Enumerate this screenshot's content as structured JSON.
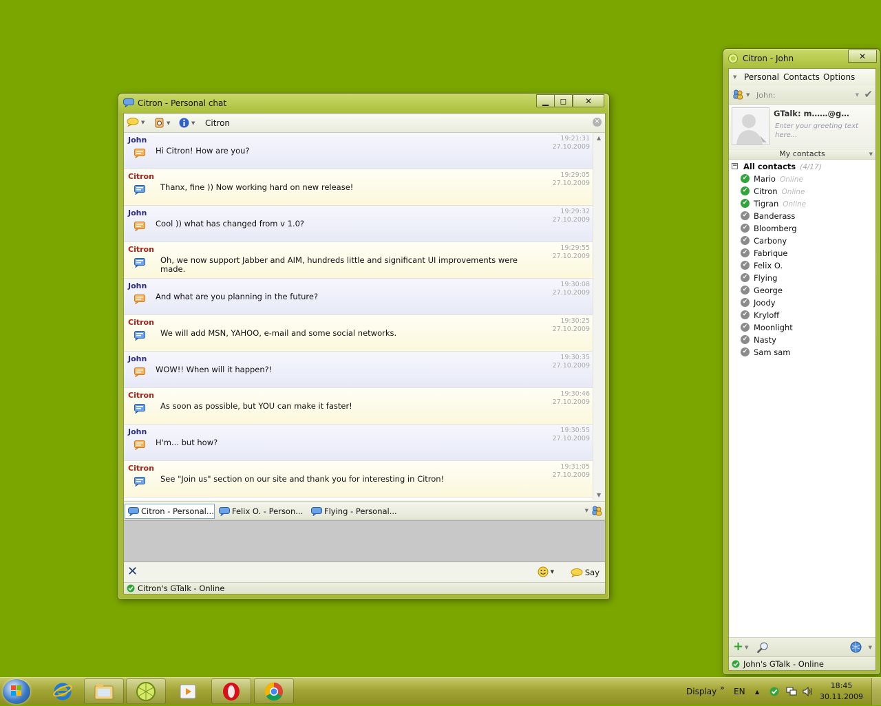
{
  "chat_window": {
    "title": "Citron - Personal chat",
    "partner_name": "Citron",
    "messages": [
      {
        "sender": "John",
        "text": "Hi Citron! How are you?",
        "time": "19:21:31",
        "date": "27.10.2009",
        "role": "john"
      },
      {
        "sender": "Citron",
        "text": "Thanx, fine )) Now working hard on new release!",
        "time": "19:29:05",
        "date": "27.10.2009",
        "role": "citron"
      },
      {
        "sender": "John",
        "text": "Cool )) what has changed from v 1.0?",
        "time": "19:29:32",
        "date": "27.10.2009",
        "role": "john"
      },
      {
        "sender": "Citron",
        "text": "Oh, we now support Jabber and AIM, hundreds little and significant UI improvements were made.",
        "time": "19:29:55",
        "date": "27.10.2009",
        "role": "citron"
      },
      {
        "sender": "John",
        "text": "And what are you planning in the future?",
        "time": "19:30:08",
        "date": "27.10.2009",
        "role": "john"
      },
      {
        "sender": "Citron",
        "text": "We will add MSN, YAHOO, e-mail and some social networks.",
        "time": "19:30:25",
        "date": "27.10.2009",
        "role": "citron"
      },
      {
        "sender": "John",
        "text": "WOW!! When will it happen?!",
        "time": "19:30:35",
        "date": "27.10.2009",
        "role": "john"
      },
      {
        "sender": "Citron",
        "text": "As soon as possible, but YOU can make it faster!",
        "time": "19:30:46",
        "date": "27.10.2009",
        "role": "citron"
      },
      {
        "sender": "John",
        "text": "H'm... but how?",
        "time": "19:30:55",
        "date": "27.10.2009",
        "role": "john"
      },
      {
        "sender": "Citron",
        "text": "See \"Join us\" section on our site and thank you for interesting in Citron!",
        "time": "19:31:05",
        "date": "27.10.2009",
        "role": "citron"
      }
    ],
    "tabs": [
      {
        "label": "Citron - Personal..."
      },
      {
        "label": "Felix O. - Person..."
      },
      {
        "label": "Flying - Personal..."
      }
    ],
    "input_value": "",
    "say_label": "Say",
    "status": "Citron's GTalk - Online"
  },
  "roster_window": {
    "title": "Citron - John",
    "menu": {
      "personal": "Personal",
      "contacts": "Contacts",
      "options": "Options"
    },
    "nick": "John:",
    "account": "GTalk: m……@g…",
    "greeting_placeholder": "Enter your greeting text here...",
    "group_header": "My contacts",
    "group": {
      "name": "All contacts",
      "count": "(4/17)"
    },
    "contacts": [
      {
        "name": "Mario",
        "status": "Online",
        "online": true
      },
      {
        "name": "Citron",
        "status": "Online",
        "online": true
      },
      {
        "name": "Tigran",
        "status": "Online",
        "online": true
      },
      {
        "name": "Banderass",
        "status": "",
        "online": false
      },
      {
        "name": "Bloomberg",
        "status": "",
        "online": false
      },
      {
        "name": "Carbony",
        "status": "",
        "online": false
      },
      {
        "name": "Fabrique",
        "status": "",
        "online": false
      },
      {
        "name": "Felix O.",
        "status": "",
        "online": false
      },
      {
        "name": "Flying",
        "status": "",
        "online": false
      },
      {
        "name": "George",
        "status": "",
        "online": false
      },
      {
        "name": "Joody",
        "status": "",
        "online": false
      },
      {
        "name": "Kryloff",
        "status": "",
        "online": false
      },
      {
        "name": "Moonlight",
        "status": "",
        "online": false
      },
      {
        "name": "Nasty",
        "status": "",
        "online": false
      },
      {
        "name": "Sam sam",
        "status": "",
        "online": false
      }
    ],
    "status": "John's GTalk - Online"
  },
  "taskbar": {
    "apps": [
      {
        "icon": "internet-explorer-icon"
      },
      {
        "icon": "file-explorer-icon"
      },
      {
        "icon": "citron-icon"
      },
      {
        "icon": "media-player-icon"
      },
      {
        "icon": "opera-icon"
      },
      {
        "icon": "chrome-icon"
      }
    ],
    "display_label": "Display",
    "chevron": "»",
    "language": "EN",
    "time": "18:45",
    "date": "30.11.2009"
  },
  "colors": {
    "desktop": "#7ba600",
    "john_name": "#2b2a8a",
    "citron_name": "#b3201a",
    "online": "#31a53c",
    "offline": "#8b8b8b"
  }
}
